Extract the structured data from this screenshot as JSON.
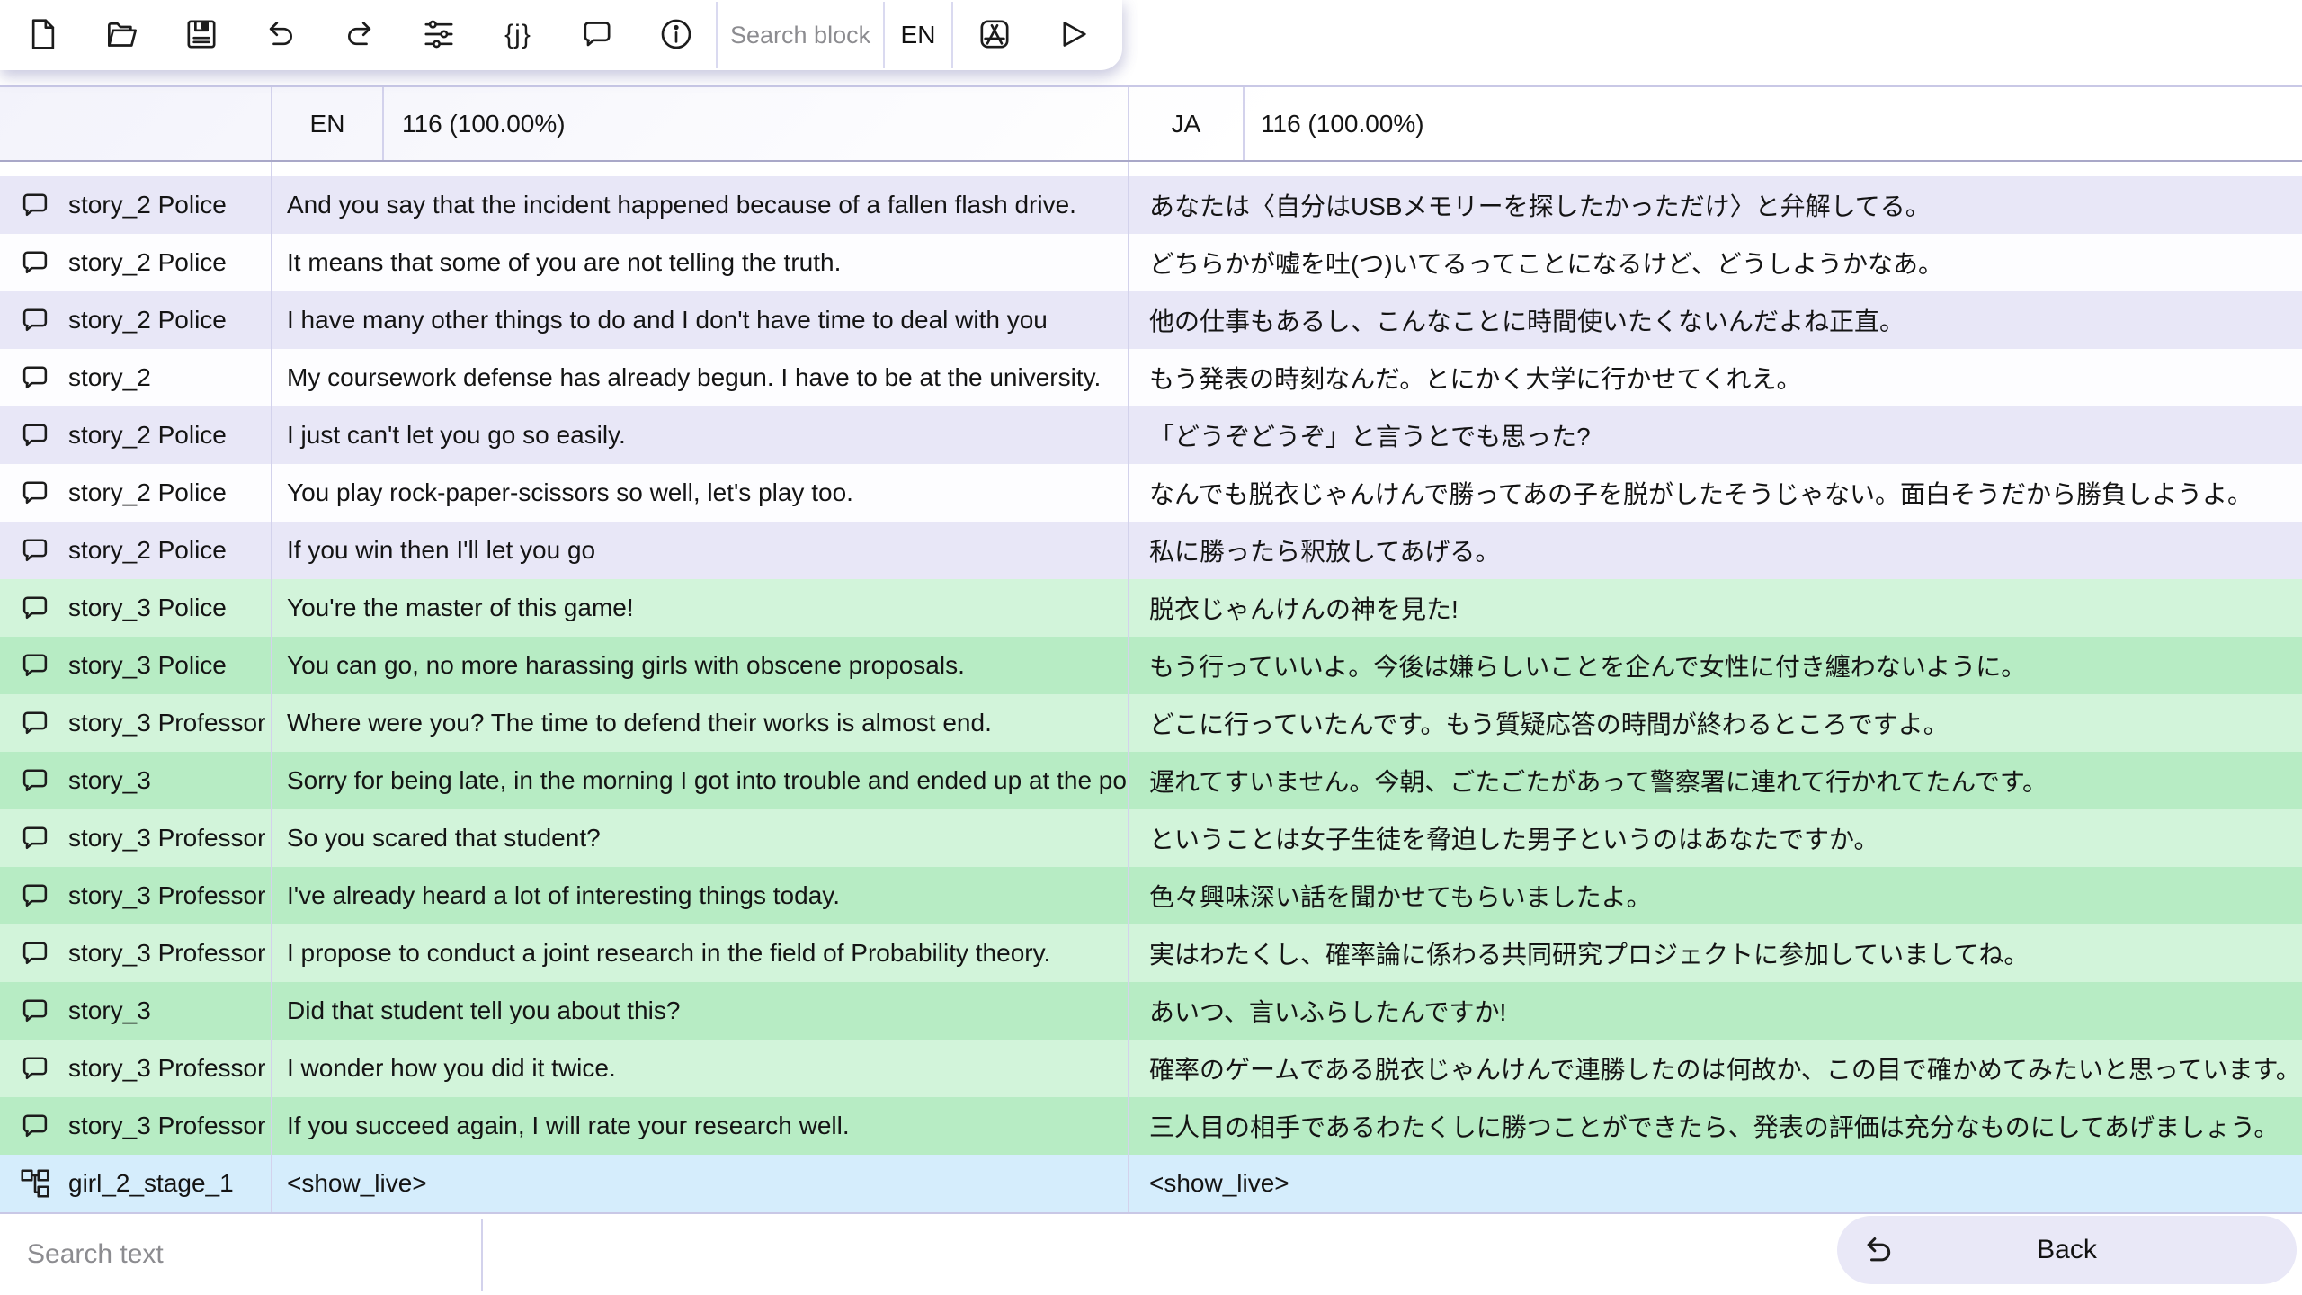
{
  "toolbar": {
    "buttons": [
      {
        "name": "new-file",
        "icon": "document-icon"
      },
      {
        "name": "open-file",
        "icon": "folder-icon"
      },
      {
        "name": "save",
        "icon": "floppy-disk-icon"
      },
      {
        "name": "undo",
        "icon": "undo-arrow-icon"
      },
      {
        "name": "redo",
        "icon": "redo-arrow-icon"
      },
      {
        "name": "filters",
        "icon": "sliders-icon"
      },
      {
        "name": "json-view",
        "icon": "curly-braces-j-icon"
      },
      {
        "name": "comments",
        "icon": "speech-bubble-icon"
      },
      {
        "name": "info",
        "icon": "info-circle-icon"
      }
    ],
    "json_glyph": "{j}",
    "search_placeholder": "Search block",
    "language_code": "EN",
    "right_icons": [
      "letter-a-slash-icon",
      "play-triangle-icon"
    ]
  },
  "table": {
    "header": {
      "en_language": "EN",
      "en_stats": "116 (100.00%)",
      "ja_language": "JA",
      "ja_stats": "116 (100.00%)"
    },
    "rows": [
      {
        "block": "story_2 Police",
        "icon": "speech-bubble",
        "color": "row_purple",
        "en": "And you say that the incident happened because of a fallen flash drive.",
        "ja": "あなたは〈自分はUSBメモリーを探したかっただけ〉と弁解してる。"
      },
      {
        "block": "story_2 Police",
        "icon": "speech-bubble",
        "color": "row_white",
        "en": "It means that some of you are not telling the truth.",
        "ja": "どちらかが嘘を吐(つ)いてるってことになるけど、どうしようかなあ。"
      },
      {
        "block": "story_2 Police",
        "icon": "speech-bubble",
        "color": "row_purple",
        "en": "I have many other things to do and I don't have time to deal with you",
        "ja": "他の仕事もあるし、こんなことに時間使いたくないんだよね正直。"
      },
      {
        "block": "story_2",
        "icon": "speech-bubble",
        "color": "row_white",
        "en": "My coursework defense has already begun. I have to be at the university.",
        "ja": "もう発表の時刻なんだ。とにかく大学に行かせてくれえ。"
      },
      {
        "block": "story_2 Police",
        "icon": "speech-bubble",
        "color": "row_purple",
        "en": "I just can't let you go so easily.",
        "ja": "「どうぞどうぞ」と言うとでも思った?"
      },
      {
        "block": "story_2 Police",
        "icon": "speech-bubble",
        "color": "row_white",
        "en": "You play rock-paper-scissors so well, let's play too.",
        "ja": "なんでも脱衣じゃんけんで勝ってあの子を脱がしたそうじゃない。面白そうだから勝負しようよ。"
      },
      {
        "block": "story_2 Police",
        "icon": "speech-bubble",
        "color": "row_purple",
        "en": "If you win then I'll let you go",
        "ja": "私に勝ったら釈放してあげる。"
      },
      {
        "block": "story_3 Police",
        "icon": "speech-bubble",
        "color": "row_green_light",
        "en": "You're the master of this game!",
        "ja": "脱衣じゃんけんの神を見た!"
      },
      {
        "block": "story_3 Police",
        "icon": "speech-bubble",
        "color": "row_green_dark",
        "en": "You can go, no more harassing girls with obscene proposals.",
        "ja": "もう行っていいよ。今後は嫌らしいことを企んで女性に付き纏わないように。"
      },
      {
        "block": "story_3 Professor",
        "icon": "speech-bubble",
        "color": "row_green_light",
        "en": "Where were you? The time to defend their works is almost end.",
        "ja": "どこに行っていたんです。もう質疑応答の時間が終わるところですよ。"
      },
      {
        "block": "story_3",
        "icon": "speech-bubble",
        "color": "row_green_dark",
        "en": "Sorry for being late, in the morning I got into trouble and ended up at the police st",
        "ja": "遅れてすいません。今朝、ごたごたがあって警察署に連れて行かれてたんです。"
      },
      {
        "block": "story_3 Professor",
        "icon": "speech-bubble",
        "color": "row_green_light",
        "en": "So you scared that student?",
        "ja": "ということは女子生徒を脅迫した男子というのはあなたですか。"
      },
      {
        "block": "story_3 Professor",
        "icon": "speech-bubble",
        "color": "row_green_dark",
        "en": "I've already heard a lot of interesting things today.",
        "ja": "色々興味深い話を聞かせてもらいましたよ。"
      },
      {
        "block": "story_3 Professor",
        "icon": "speech-bubble",
        "color": "row_green_light",
        "en": "I propose to conduct a joint research in the field of Probability theory.",
        "ja": "実はわたくし、確率論に係わる共同研究プロジェクトに参加していましてね。"
      },
      {
        "block": "story_3",
        "icon": "speech-bubble",
        "color": "row_green_dark",
        "en": "Did that student tell you about this?",
        "ja": "あいつ、言いふらしたんですか!"
      },
      {
        "block": "story_3 Professor",
        "icon": "speech-bubble",
        "color": "row_green_light",
        "en": "I wonder how you did it twice.",
        "ja": "確率のゲームである脱衣じゃんけんで連勝したのは何故か、この目で確かめてみたいと思っています。"
      },
      {
        "block": "story_3 Professor",
        "icon": "speech-bubble",
        "color": "row_green_dark",
        "en": "If you succeed again, I will rate your research well.",
        "ja": "三人目の相手であるわたくしに勝つことができたら、発表の評価は充分なものにしてあげましょう。"
      },
      {
        "block": "girl_2_stage_1",
        "icon": "flowchart",
        "color": "row_blue",
        "en": "<show_live>",
        "ja": "<show_live>"
      }
    ]
  },
  "footer": {
    "search_placeholder": "Search text",
    "back_label": "Back",
    "back_icon": "undo-arrow-icon"
  },
  "colors": {
    "row_purple": "#e8e7f7",
    "row_white": "#fdfdff",
    "row_green_light": "#d2f4da",
    "row_green_dark": "#b7ecc4",
    "row_blue": "#d5edfc",
    "grid_line": "#d3d2ec",
    "table_border": "#c9c8e6",
    "header_divider": "#a9a8c8",
    "toolbar_divider": "#dadaf0",
    "back_pill": "#e9e8f7",
    "placeholder_text": "#8c8c90",
    "text": "#141414"
  }
}
